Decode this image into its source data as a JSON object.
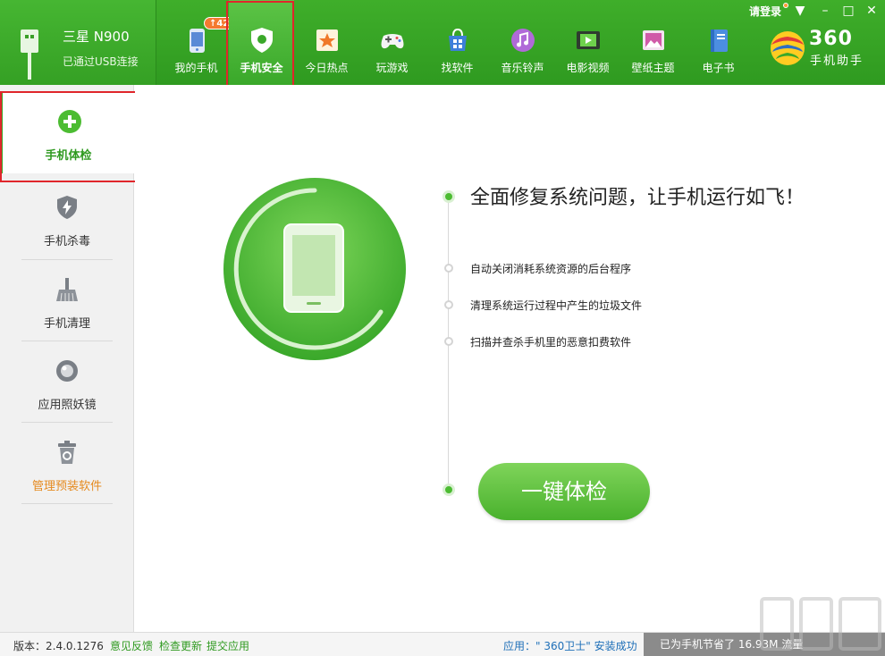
{
  "device": {
    "name": "三星 N900",
    "status": "已通过USB连接"
  },
  "nav": [
    {
      "label": "我的手机",
      "icon": "phone-icon",
      "badge": "↑42"
    },
    {
      "label": "手机安全",
      "icon": "shield-icon",
      "active": true
    },
    {
      "label": "今日热点",
      "icon": "star-news-icon"
    },
    {
      "label": "玩游戏",
      "icon": "gamepad-icon"
    },
    {
      "label": "找软件",
      "icon": "app-store-icon"
    },
    {
      "label": "音乐铃声",
      "icon": "music-icon"
    },
    {
      "label": "电影视频",
      "icon": "film-icon"
    },
    {
      "label": "壁纸主题",
      "icon": "wallpaper-icon"
    },
    {
      "label": "电子书",
      "icon": "book-icon"
    }
  ],
  "window": {
    "login": "请登录"
  },
  "logo": {
    "big": "360",
    "small": "手机助手"
  },
  "sidebar": [
    {
      "label": "手机体检",
      "icon": "plus-circle-icon",
      "active": true
    },
    {
      "label": "手机杀毒",
      "icon": "lightning-shield-icon"
    },
    {
      "label": "手机清理",
      "icon": "broom-icon"
    },
    {
      "label": "应用照妖镜",
      "icon": "lens-icon"
    },
    {
      "label": "管理预装软件",
      "icon": "trash-can-icon",
      "highlight": "orange"
    }
  ],
  "main": {
    "headline": "全面修复系统问题，让手机运行如飞！",
    "features": [
      "自动关闭消耗系统资源的后台程序",
      "清理系统运行过程中产生的垃圾文件",
      "扫描并查杀手机里的恶意扣费软件"
    ],
    "button": "一键体检"
  },
  "statusbar": {
    "version": "版本：2.4.0.1276",
    "links": [
      "意见反馈",
      "检查更新",
      "提交应用"
    ],
    "install": "应用：\" 360卫士\" 安装成功",
    "saved": "已为手机节省了 16.93M 流量"
  },
  "colors": {
    "brand_green": "#2f9a20",
    "accent_orange": "#f47a30",
    "highlight_red": "#e0262b"
  }
}
